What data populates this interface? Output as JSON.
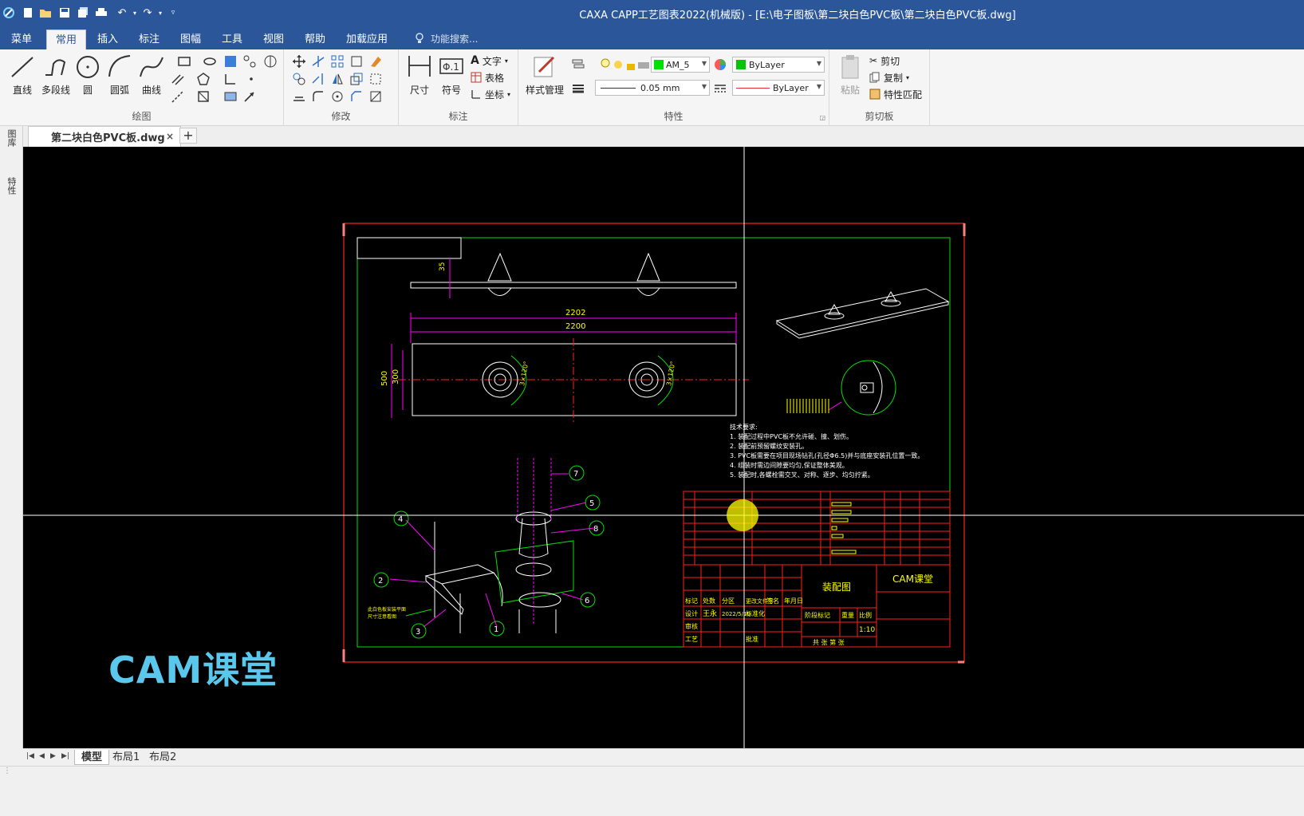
{
  "window": {
    "title": "CAXA CAPP工艺图表2022(机械版) - [E:\\电子图板\\第二块白色PVC板\\第二块白色PVC板.dwg]"
  },
  "menu": {
    "tabs": [
      "菜单",
      "常用",
      "插入",
      "标注",
      "图幅",
      "工具",
      "视图",
      "帮助",
      "加载应用"
    ],
    "active": "常用",
    "search_placeholder": "功能搜索..."
  },
  "ribbon": {
    "draw_group": {
      "label": "绘图",
      "line": "直线",
      "polyline": "多段线",
      "circle": "圆",
      "arc": "圆弧",
      "curve": "曲线"
    },
    "modify_group": {
      "label": "修改"
    },
    "annotate_group": {
      "label": "标注",
      "dimension": "尺寸",
      "symbol": "符号",
      "text": "文字",
      "table": "表格",
      "coord": "坐标"
    },
    "properties_group": {
      "label": "特性",
      "style_manager": "样式管理",
      "layer": "AM_5",
      "color": "ByLayer",
      "lineweight": "0.05 mm",
      "linetype": "ByLayer"
    },
    "clipboard_group": {
      "label": "剪切板",
      "paste": "粘贴",
      "cut": "剪切",
      "copy": "复制",
      "match": "特性匹配"
    }
  },
  "left_strip": {
    "tab1": "图库",
    "tab2": "特性"
  },
  "document": {
    "tab_label": "第二块白色PVC板.dwg",
    "close": "×",
    "add": "+"
  },
  "drawing": {
    "dims": {
      "top": "35",
      "outer_width": "2202",
      "inner_width": "2200",
      "outer_height": "500",
      "inner_height": "300",
      "hole_angle": "3×120°"
    },
    "tech_requirements": {
      "title": "技术要求:",
      "items": [
        "1.  装配过程中PVC板不允许碰、撞、划伤。",
        "2.  装配前预留螺纹安装孔。",
        "3.  PVC板需要在项目现场钻孔(孔径Φ6.5)并与底座安装孔位置一致。",
        "4.  组装时需边间隙要均匀,保证整体美观。",
        "5.  装配时,各螺栓需交叉、对称、逐步、均匀拧紧。"
      ]
    },
    "balloons": [
      "1",
      "2",
      "3",
      "4",
      "5",
      "6",
      "7",
      "8"
    ],
    "note": [
      "此白色板安装平面",
      "尺寸注意看图"
    ],
    "title_block": {
      "drawing_name": "装配图",
      "company": "CAM课堂",
      "scale": "1:10",
      "designer": "王永",
      "date": "2022/5/10",
      "stage_label": "阶段标记",
      "weight_label": "重量",
      "scale_label": "比例",
      "sheet_label": "共 张 第 张",
      "review": "审核",
      "process": "工艺",
      "approve": "批准",
      "design": "设计",
      "std": "标准化",
      "mark_header": [
        "标记",
        "处数",
        "分区",
        "更改文件号",
        "签名",
        "年月日"
      ]
    }
  },
  "watermark": "CAM课堂",
  "layout_tabs": [
    "模型",
    "布局1",
    "布局2"
  ],
  "colors": {
    "accent": "#2b579a",
    "frame_red": "#ff2020",
    "border_green": "#00e000",
    "dim_magenta": "#ff00ff",
    "text_yellow": "#ffff00",
    "watermark": "#5ac8ec"
  }
}
